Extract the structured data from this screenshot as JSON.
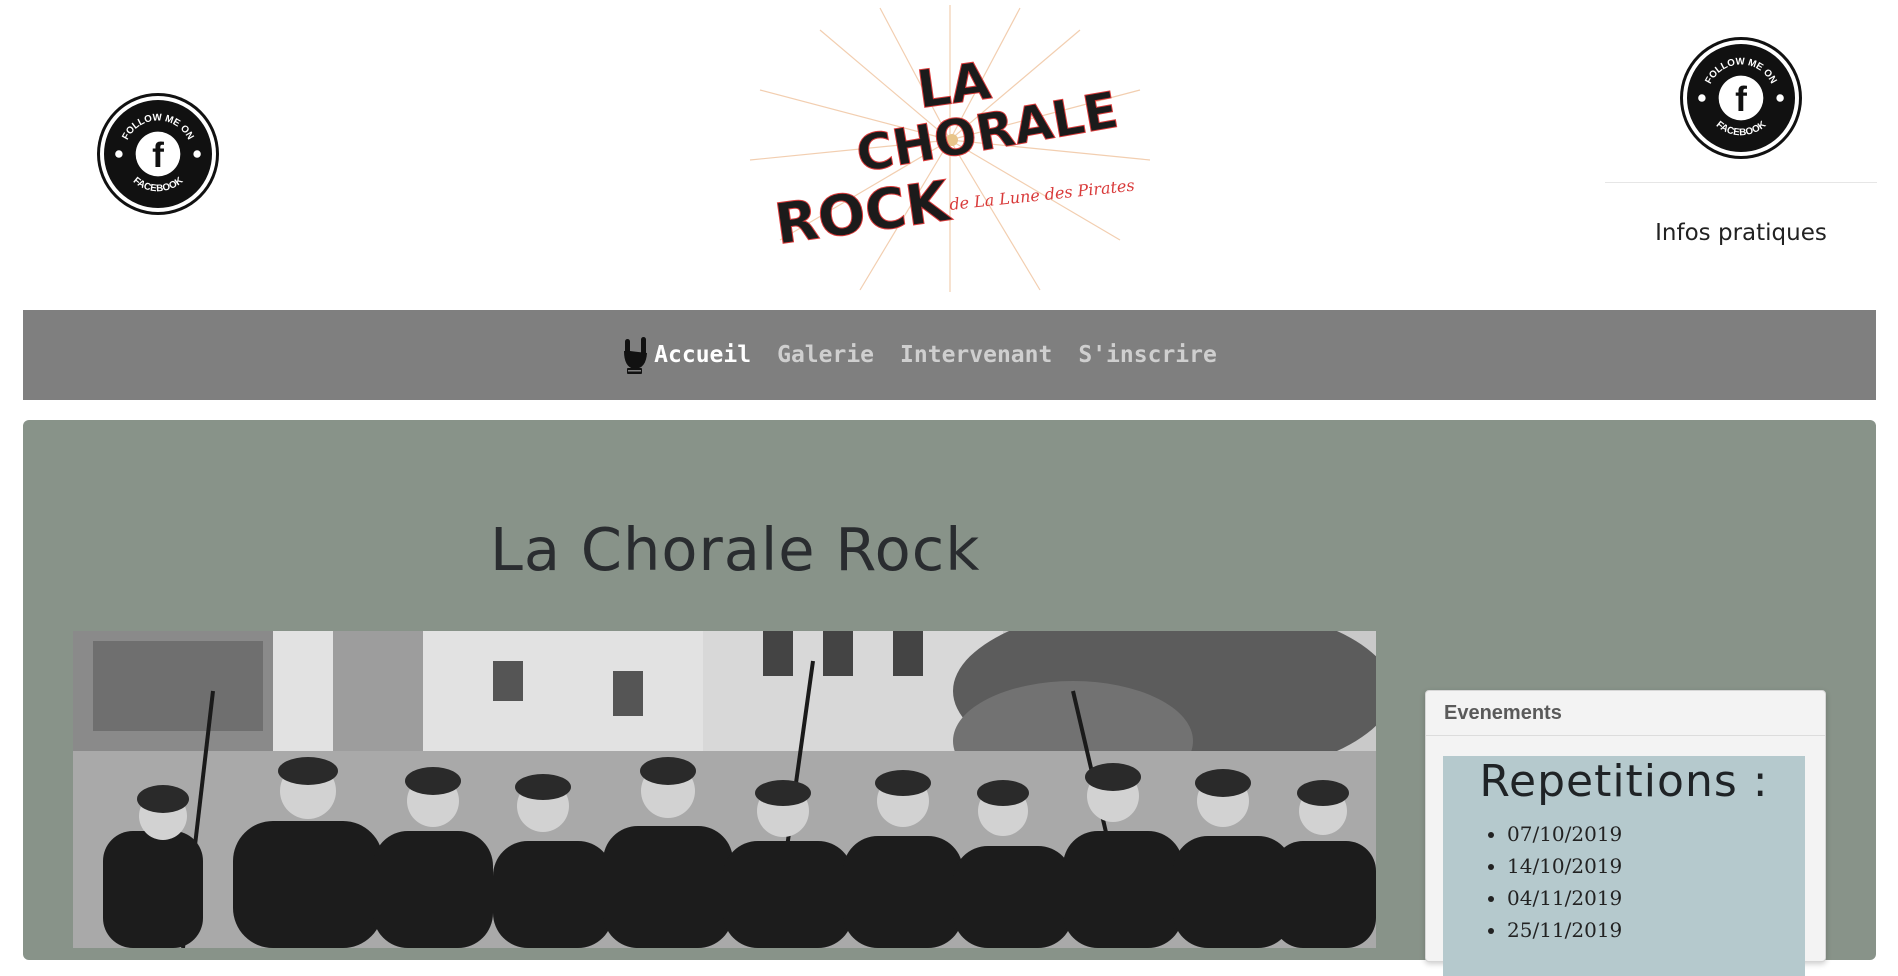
{
  "header": {
    "logo": {
      "line1": "LA",
      "line2": "CHORALE",
      "line3": "ROCK",
      "tagline": "de La Lune des Pirates"
    },
    "facebook_badge": {
      "top_text": "FOLLOW ME ON",
      "bottom_text": "FACEBOOK",
      "letter": "f"
    },
    "infos_link": "Infos pratiques"
  },
  "nav": {
    "items": [
      {
        "label": "Accueil",
        "active": true,
        "icon": "rock-hand-icon"
      },
      {
        "label": "Galerie",
        "active": false
      },
      {
        "label": "Intervenant",
        "active": false
      },
      {
        "label": "S'inscrire",
        "active": false
      }
    ]
  },
  "main": {
    "title": "La Chorale Rock",
    "photo_icon": "choir-photo"
  },
  "sidebar": {
    "card_title": "Evenements",
    "repetitions_title": "Repetitions :",
    "dates": [
      "07/10/2019",
      "14/10/2019",
      "04/11/2019",
      "25/11/2019"
    ]
  },
  "colors": {
    "nav_bg": "#7f7f7f",
    "panel_bg": "#889389",
    "card_body_bg": "#b5c9cd",
    "logo_red": "#d93a3a"
  }
}
